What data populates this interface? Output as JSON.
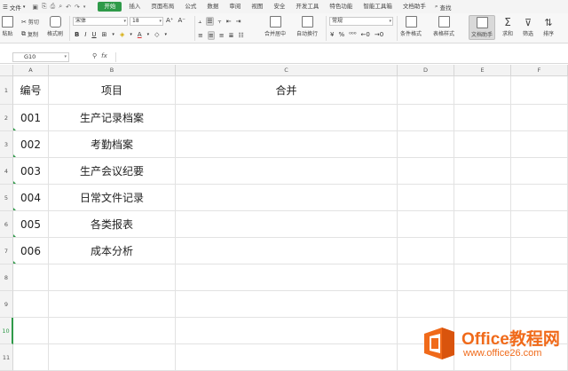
{
  "menubar": {
    "file_label": "文件",
    "tabs": [
      {
        "label": "开始",
        "active": true
      },
      {
        "label": "插入"
      },
      {
        "label": "页面布局"
      },
      {
        "label": "公式"
      },
      {
        "label": "数据"
      },
      {
        "label": "审阅"
      },
      {
        "label": "视图"
      },
      {
        "label": "安全"
      },
      {
        "label": "开发工具"
      },
      {
        "label": "特色功能"
      },
      {
        "label": "智能工具箱"
      },
      {
        "label": "文档助手"
      }
    ],
    "search_label": "查找"
  },
  "ribbon": {
    "paste": "粘贴",
    "cut": "剪切",
    "copy": "复制",
    "format_painter": "格式刷",
    "font_name": "宋体",
    "font_size": "18",
    "merge_center": "合并居中",
    "wrap_text": "自动换行",
    "number_format": "常规",
    "conditional_format": "条件格式",
    "table_style": "表格样式",
    "doc_assistant": "文档助手",
    "sum": "求和",
    "filter": "筛选",
    "sort": "排序"
  },
  "formula_bar": {
    "cell_ref": "G10",
    "formula": ""
  },
  "columns": [
    "A",
    "B",
    "C",
    "D",
    "E",
    "F"
  ],
  "rows": [
    {
      "num": "1",
      "cells": [
        "编号",
        "项目",
        "合并"
      ]
    },
    {
      "num": "2",
      "cells": [
        "001",
        "生产记录档案",
        ""
      ]
    },
    {
      "num": "3",
      "cells": [
        "002",
        "考勤档案",
        ""
      ]
    },
    {
      "num": "4",
      "cells": [
        "003",
        "生产会议纪要",
        ""
      ]
    },
    {
      "num": "5",
      "cells": [
        "004",
        "日常文件记录",
        ""
      ]
    },
    {
      "num": "6",
      "cells": [
        "005",
        "各类报表",
        ""
      ]
    },
    {
      "num": "7",
      "cells": [
        "006",
        "成本分析",
        ""
      ]
    },
    {
      "num": "8",
      "cells": [
        "",
        "",
        ""
      ]
    },
    {
      "num": "9",
      "cells": [
        "",
        "",
        ""
      ]
    },
    {
      "num": "10",
      "cells": [
        "",
        "",
        ""
      ]
    },
    {
      "num": "11",
      "cells": [
        "",
        "",
        ""
      ]
    }
  ],
  "selected_row": "10",
  "watermark": {
    "title": "Office教程网",
    "url": "www.office26.com"
  },
  "colors": {
    "accent": "#2f9a49",
    "watermark": "#f06a1a"
  }
}
